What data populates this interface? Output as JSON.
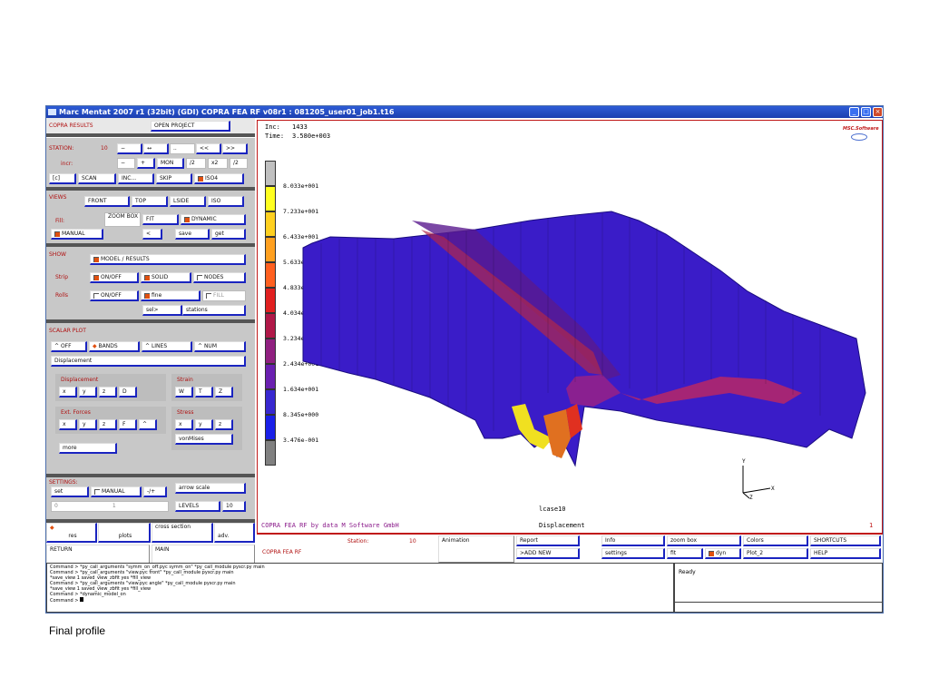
{
  "window": {
    "title": "Marc Mentat 2007 r1 (32bit) (GDI) COPRA FEA RF v08r1 : 081205_user01_job1.t16",
    "min_label": "_",
    "max_label": "□",
    "close_label": "×"
  },
  "panel": {
    "header_left": "COPRA RESULTS",
    "header_right": "OPEN PROJECT",
    "station_label": "STATION:",
    "station_value": "10",
    "station_buttons": [
      "−",
      "↔",
      "..",
      "<<",
      ">>"
    ],
    "incr_label": "incr:",
    "incr_buttons": [
      "−",
      "+",
      "MON",
      "/2",
      "x2",
      "/2"
    ],
    "row3": [
      "[c]",
      "SCAN",
      "INC...",
      "SKIP",
      "ISO4"
    ],
    "views_label": "VIEWS",
    "views_buttons": [
      "FRONT",
      "TOP",
      "LSIDE",
      "ISO"
    ],
    "fill_label": "Fill:",
    "zoom_label": "ZOOM BOX",
    "fit_label": "FIT",
    "dynamic_label": "DYNAMIC",
    "manual_label": "MANUAL",
    "lt_label": "<",
    "save_label": "save",
    "get_label": "get",
    "show_label": "SHOW",
    "model_results": "MODEL / RESULTS",
    "strip_label": "Strip",
    "onoff1": "ON/OFF",
    "solid": "SOLID",
    "nodes": "NODES",
    "rolls_label": "Rolls",
    "onoff2": "ON/OFF",
    "fine": "fine",
    "fill": "FILL",
    "sel": "sel>",
    "stations": "stations",
    "scalar_label": "SCALAR PLOT",
    "off": "OFF",
    "bands": "BANDS",
    "lines": "LINES",
    "num": "NUM",
    "scalar_value": "Displacement",
    "displacement_label": "Displacement",
    "disp_buttons": [
      "x",
      "y",
      "z",
      "D"
    ],
    "strain_label": "Strain",
    "strain_buttons": [
      "W",
      "T",
      "Z"
    ],
    "extforces_label": "Ext. Forces",
    "ext_buttons": [
      "x",
      "y",
      "z",
      "F",
      "^"
    ],
    "stress_label": "Stress",
    "stress_buttons": [
      "x",
      "y",
      "z"
    ],
    "vonmises": "vonMises",
    "more": "more",
    "settings_label": "SETTINGS:",
    "set": "set",
    "manual2": "MANUAL",
    "plusminus": "-/+",
    "arrow_scale": "arrow scale",
    "field_left": "0",
    "field_mid": "1",
    "levels": "LEVELS",
    "levels_value": "10",
    "bottom_buttons": [
      "res",
      "plots",
      "cross section",
      "adv."
    ],
    "return": "RETURN",
    "main": "MAIN"
  },
  "viewport": {
    "inc_label": "Inc:",
    "inc_value": "1433",
    "time_label": "Time:",
    "time_value": "3.580e+003",
    "logo_text": "MSC.Software",
    "footer_left": "COPRA FEA RF by data M Software GmbH",
    "footer_mid": "Displacement",
    "footer_right": "1",
    "case_label": "lcase10",
    "axis_x": "X",
    "axis_y": "Y",
    "axis_z": "Z",
    "legend_values": [
      "8.033e+001",
      "7.233e+001",
      "6.433e+001",
      "5.633e+001",
      "4.833e+001",
      "4.034e+001",
      "3.234e+001",
      "2.434e+001",
      "1.634e+001",
      "8.345e+000",
      "3.476e-001"
    ],
    "legend_colors": [
      "#c0c0c0",
      "#ffff20",
      "#ffd020",
      "#ffa020",
      "#ff6020",
      "#e02020",
      "#b01848",
      "#902080",
      "#6a20b0",
      "#3828d0",
      "#1a20e8",
      "#808080"
    ]
  },
  "bottombar": {
    "copra_fea": "COPRA FEA RF",
    "station_label": "Station:",
    "station_value": "10",
    "animation": "Animation",
    "report": "Report",
    "add_new": ">ADD NEW",
    "info": "Info",
    "settings": "settings",
    "zoom_box": "zoom box",
    "fit": "fit",
    "dyn": "dyn",
    "colors": "Colors",
    "plot2": "Plot_2",
    "shortcuts": "SHORTCUTS",
    "help": "HELP"
  },
  "command": {
    "lines": [
      "Command > *py_call_arguments \"symm_on_off.pyc symm_on\" *py_call_module pyscr.py main",
      "Command > *py_call_arguments \"view.pyc front\" *py_call_module pyscr.py main",
      "*save_view 1 saved_view_zbfit yes *fill_view",
      "Command > *py_call_arguments \"view.pyc angle\" *py_call_module pyscr.py main",
      "*save_view 1 saved_view_zbfit yes *fill_view",
      "Command > *dynamic_model_on",
      "Command >"
    ],
    "status": "Ready"
  },
  "slide_caption": "Final profile"
}
